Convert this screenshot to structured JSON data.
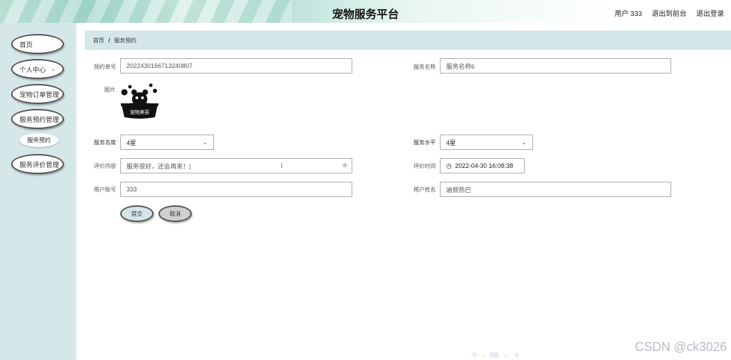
{
  "header": {
    "title": "宠物服务平台",
    "links": [
      "用户 333",
      "退出到前台",
      "退出登录"
    ]
  },
  "sidebar": {
    "items": [
      {
        "label": "首页"
      },
      {
        "label": "个人中心",
        "chevron": "chevron-down-icon"
      },
      {
        "label": "宠物订单管理"
      },
      {
        "label": "服务预约管理"
      },
      {
        "label": "服务预约",
        "sub": true
      },
      {
        "label": "服务评价管理"
      }
    ]
  },
  "breadcrumb": {
    "home": "首页",
    "separator": "/",
    "current": "服务预约"
  },
  "form": {
    "order_no": {
      "label": "预约单号",
      "value": "2022430166713240807"
    },
    "service_name": {
      "label": "服务名称",
      "value": "服务名称6"
    },
    "image": {
      "label": "图片",
      "logo_text": "宠物美容"
    },
    "service_attitude": {
      "label": "服务态度",
      "value": "4星"
    },
    "service_level": {
      "label": "服务水平",
      "value": "4星"
    },
    "review_content": {
      "label": "评价内容",
      "value": "服务很好，还会再来！|"
    },
    "review_time": {
      "label": "评价时间",
      "value": "2022-04-30 16:08:38"
    },
    "user_account": {
      "label": "用户账号",
      "value": "333"
    },
    "user_name": {
      "label": "用户姓名",
      "value": "迪丽热巴"
    }
  },
  "buttons": {
    "submit": "提交",
    "cancel": "取消"
  },
  "watermark": "CSDN @ck3026",
  "ime_toolbar": "中 ♪ ⌨ ☺ ⚙"
}
